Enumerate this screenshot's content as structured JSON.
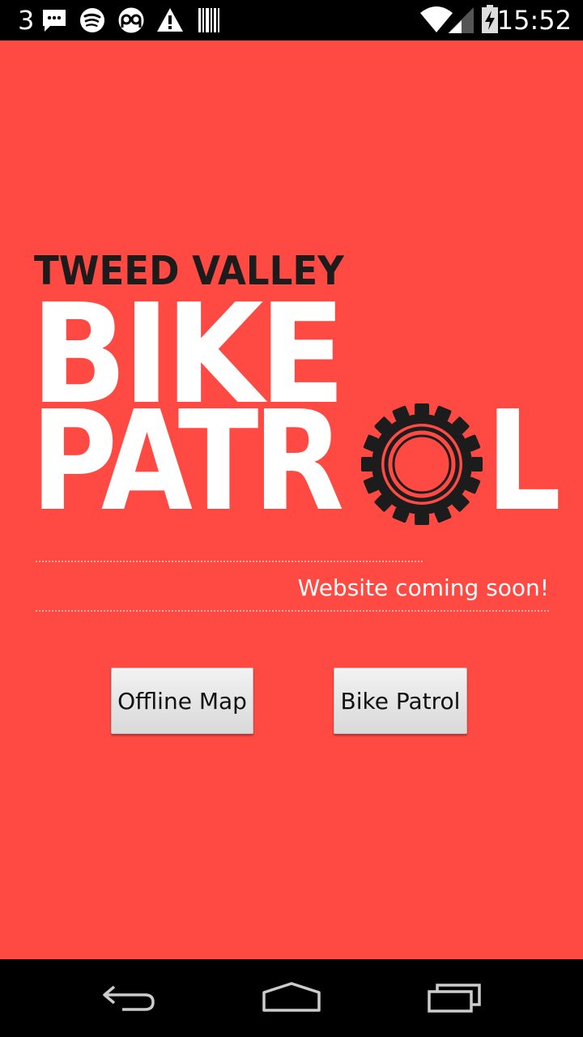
{
  "status_bar": {
    "notification_count": "3",
    "time": "15:52",
    "icons": [
      "message-icon",
      "spotify-icon",
      "app-icon",
      "warning-icon",
      "barcode-icon",
      "wifi-icon",
      "signal-icon",
      "battery-charging-icon"
    ]
  },
  "logo": {
    "line1": "TWEED VALLEY",
    "line2": "BIKE",
    "line3_start": "PATR",
    "line3_end": "L",
    "gear_letter_icon": "gear-icon"
  },
  "tagline": "Website coming soon!",
  "buttons": {
    "offline_map": "Offline Map",
    "bike_patrol": "Bike Patrol"
  },
  "nav_bar": {
    "icons": [
      "back-icon",
      "home-icon",
      "recent-apps-icon"
    ]
  },
  "colors": {
    "background": "#ff4a43",
    "logo_dark": "#1c1c1c",
    "logo_light": "#ffffff"
  }
}
